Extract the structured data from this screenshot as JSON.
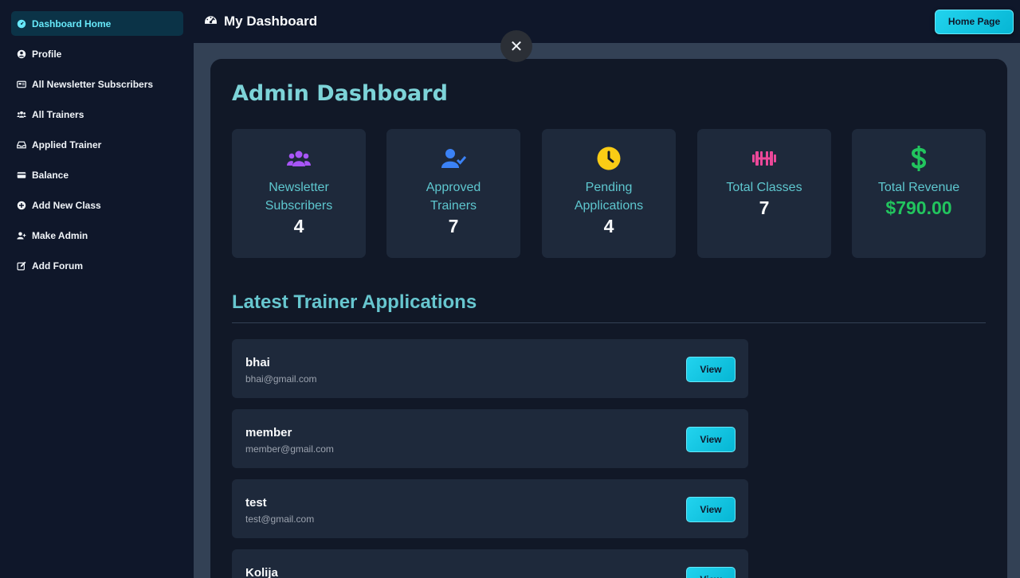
{
  "sidebar": {
    "items": [
      {
        "label": "Dashboard Home",
        "icon": "gauge-icon"
      },
      {
        "label": "Profile",
        "icon": "user-circle-icon"
      },
      {
        "label": "All Newsletter Subscribers",
        "icon": "newspaper-icon"
      },
      {
        "label": "All Trainers",
        "icon": "users-icon"
      },
      {
        "label": "Applied Trainer",
        "icon": "inbox-icon"
      },
      {
        "label": "Balance",
        "icon": "credit-card-icon"
      },
      {
        "label": "Add New Class",
        "icon": "plus-circle-icon"
      },
      {
        "label": "Make Admin",
        "icon": "user-plus-icon"
      },
      {
        "label": "Add Forum",
        "icon": "edit-icon"
      }
    ]
  },
  "header": {
    "title": "My Dashboard",
    "home_button": "Home Page"
  },
  "main": {
    "close_label": "✕",
    "title": "Admin Dashboard",
    "stats": [
      {
        "label_1": "Newsletter",
        "label_2": "Subscribers",
        "value": "4",
        "icon": "users-icon",
        "color": "#a855f7"
      },
      {
        "label_1": "Approved",
        "label_2": "Trainers",
        "value": "7",
        "icon": "user-check-icon",
        "color": "#3b82f6"
      },
      {
        "label_1": "Pending",
        "label_2": "Applications",
        "value": "4",
        "icon": "clock-icon",
        "color": "#facc15"
      },
      {
        "label_1": "Total Classes",
        "label_2": "",
        "value": "7",
        "icon": "dumbbell-icon",
        "color": "#ec4899"
      },
      {
        "label_1": "Total Revenue",
        "label_2": "",
        "value": "$790.00",
        "icon": "dollar-icon",
        "color": "#22c55e"
      }
    ],
    "section_title": "Latest Trainer Applications",
    "applications": [
      {
        "name": "bhai",
        "email": "bhai@gmail.com",
        "button": "View"
      },
      {
        "name": "member",
        "email": "member@gmail.com",
        "button": "View"
      },
      {
        "name": "test",
        "email": "test@gmail.com",
        "button": "View"
      },
      {
        "name": "Kolija",
        "email": "",
        "button": "View"
      }
    ]
  }
}
